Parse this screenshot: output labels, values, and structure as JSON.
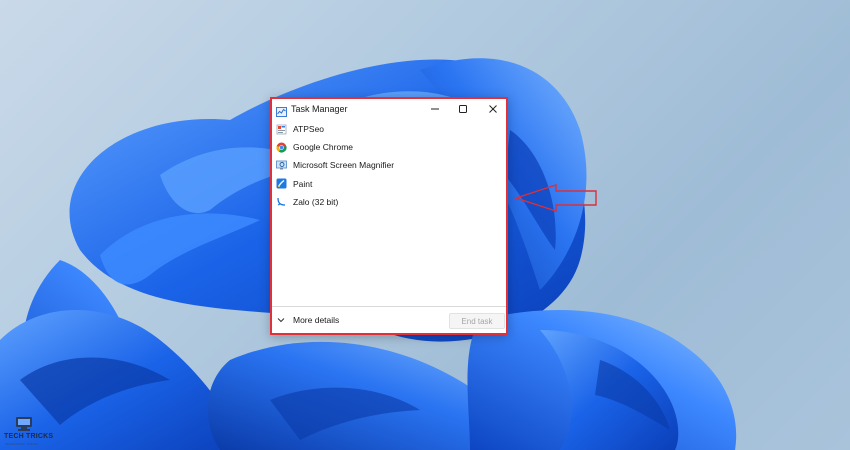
{
  "window": {
    "title": "Task Manager",
    "controls": {
      "minimize": "minimize-icon",
      "maximize": "maximize-icon",
      "close": "close-icon"
    },
    "highlight_color": "#e0303a"
  },
  "apps": [
    {
      "label": "ATPSeo",
      "icon": "atpseo-app-icon"
    },
    {
      "label": "Google Chrome",
      "icon": "chrome-icon"
    },
    {
      "label": "Microsoft Screen Magnifier",
      "icon": "magnifier-icon"
    },
    {
      "label": "Paint",
      "icon": "paint-icon"
    },
    {
      "label": "Zalo (32 bit)",
      "icon": "zalo-icon"
    }
  ],
  "footer": {
    "more_details": "More details",
    "end_task": "End task"
  },
  "watermark": {
    "brand": "TECH TRICKS",
    "tagline": "TECHNOLOGY TRICKS"
  },
  "colors": {
    "wallpaper_bloom": "#1a63e8",
    "wallpaper_background": "#b3cbe0",
    "annotation_arrow": "#d9303a"
  }
}
